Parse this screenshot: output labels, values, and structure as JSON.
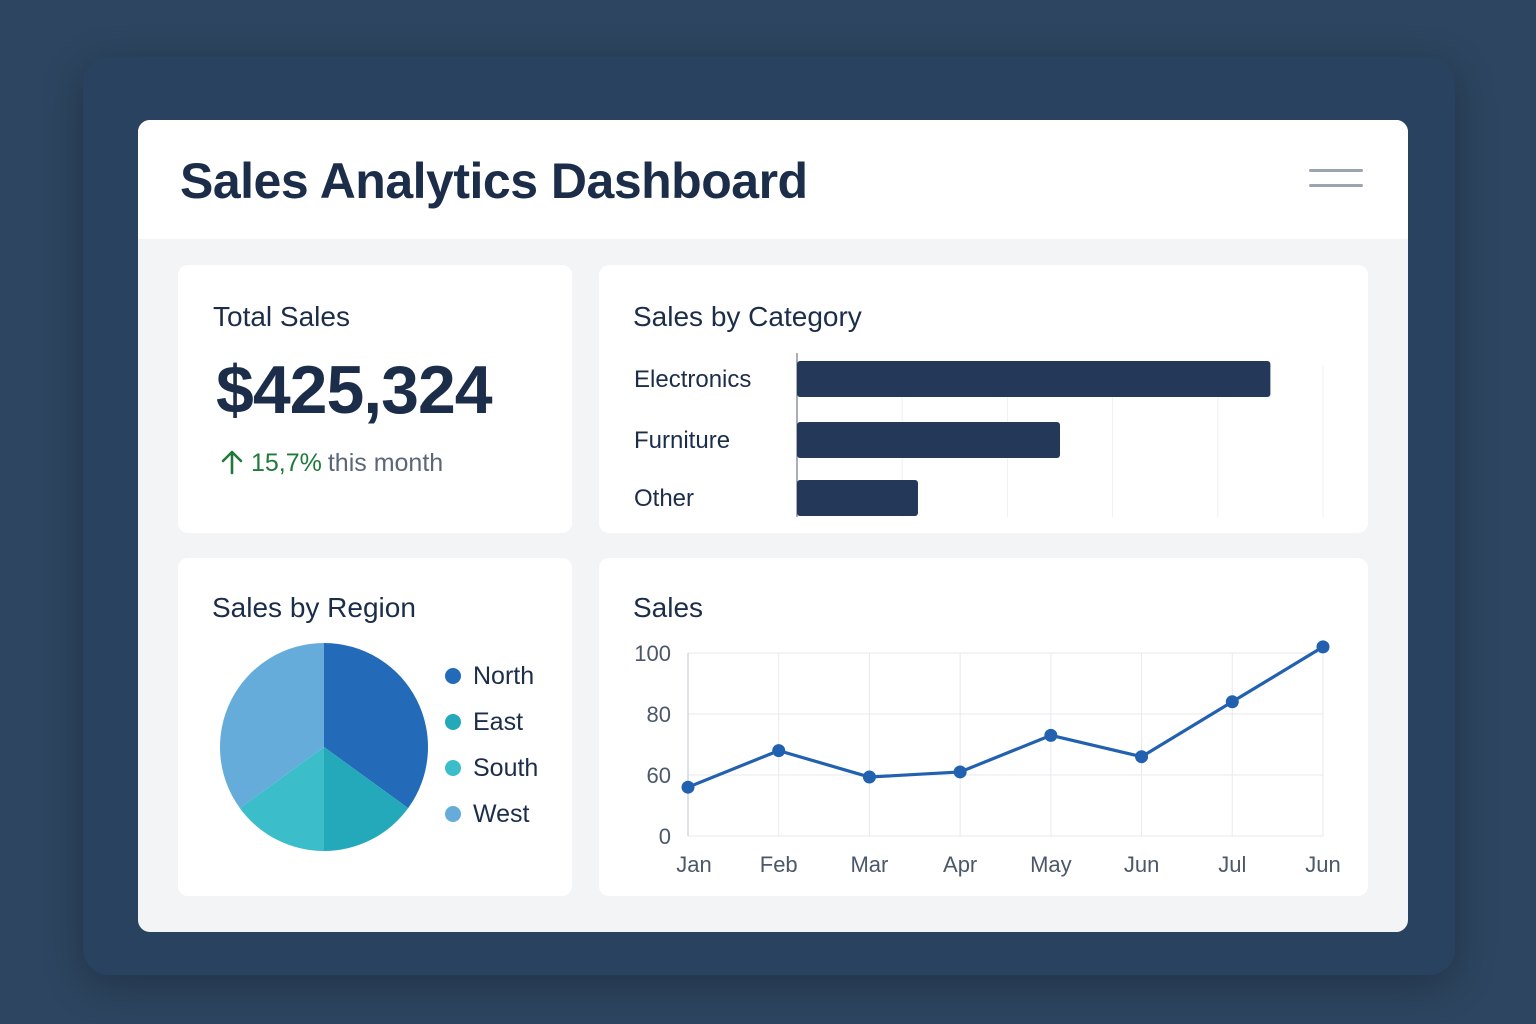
{
  "header": {
    "title": "Sales Analytics Dashboard"
  },
  "total_sales": {
    "title": "Total Sales",
    "value": "$425,324",
    "change": "15,7%",
    "change_label": "this month",
    "change_color": "#1f7a3c"
  },
  "chart_data": [
    {
      "type": "bar",
      "title": "Sales by Category",
      "orientation": "horizontal",
      "categories": [
        "Electronics",
        "Furniture",
        "Other"
      ],
      "values": [
        90,
        50,
        23
      ],
      "xlim": [
        0,
        100
      ],
      "grid": true,
      "color": "#24395a"
    },
    {
      "type": "pie",
      "title": "Sales by Region",
      "labels": [
        "North",
        "East",
        "South",
        "West"
      ],
      "values": [
        35,
        15,
        15,
        35
      ],
      "colors": [
        "#236bb8",
        "#24a9bb",
        "#3bbdca",
        "#66acdb"
      ],
      "legend": "right"
    },
    {
      "type": "line",
      "title": "Sales",
      "x": [
        "Jan",
        "Feb",
        "Mar",
        "Apr",
        "May",
        "Jun",
        "Jul",
        "Jun"
      ],
      "y": [
        48,
        68,
        58,
        61,
        73,
        66,
        84,
        102
      ],
      "yticks": [
        "0",
        "60",
        "80",
        "100"
      ],
      "grid": true,
      "color": "#2260b0"
    }
  ]
}
